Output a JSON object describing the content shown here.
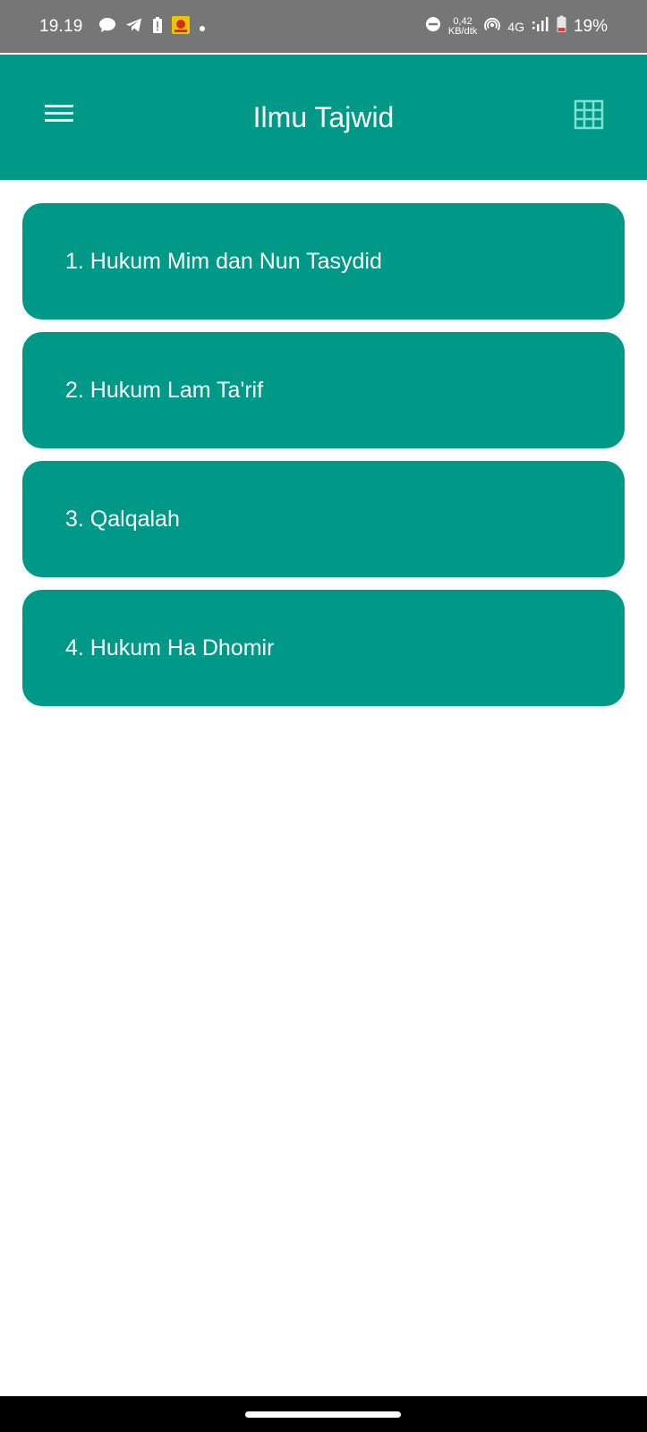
{
  "status_bar": {
    "time": "19.19",
    "net_speed_value": "0,42",
    "net_speed_unit": "KB/dtk",
    "network_type": "4G",
    "battery": "19%"
  },
  "app_bar": {
    "title": "Ilmu Tajwid",
    "accent_color": "#009987"
  },
  "topics": [
    {
      "label": "1. Hukum Mim dan Nun Tasydid"
    },
    {
      "label": "2. Hukum Lam Ta'rif"
    },
    {
      "label": "3. Qalqalah"
    },
    {
      "label": "4. Hukum Ha Dhomir"
    }
  ]
}
